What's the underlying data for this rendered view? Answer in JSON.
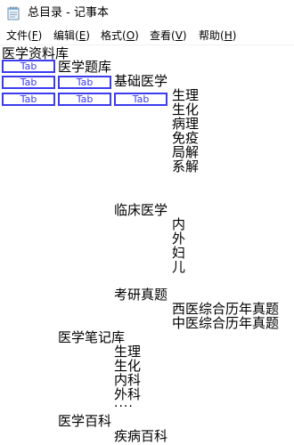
{
  "window": {
    "title": "总目录 - 记事本",
    "icon": "notepad-icon"
  },
  "menu": [
    {
      "label": "文件(",
      "accel": "F",
      "suffix": ")"
    },
    {
      "label": "编辑(",
      "accel": "E",
      "suffix": ")"
    },
    {
      "label": "格式(",
      "accel": "O",
      "suffix": ")"
    },
    {
      "label": "查看(",
      "accel": "V",
      "suffix": ")"
    },
    {
      "label": "帮助(",
      "accel": "H",
      "suffix": ")"
    }
  ],
  "tab_label": "Tab",
  "content": {
    "root": "医学资料库",
    "tiku": "医学题库",
    "jichu": "基础医学",
    "jichu_items": [
      "生理",
      "生化",
      "病理",
      "免疫",
      "局解",
      "系解"
    ],
    "linchuang": "临床医学",
    "linchuang_items": [
      "内",
      "外",
      "妇",
      "儿"
    ],
    "kaoyan": "考研真题",
    "kaoyan_items": [
      "西医综合历年真题",
      "中医综合历年真题"
    ],
    "biji": "医学笔记库",
    "biji_items": [
      "生理",
      "生化",
      "内科",
      "外科",
      "····"
    ],
    "baike": "医学百科",
    "baike_items": [
      "疾病百科"
    ]
  }
}
